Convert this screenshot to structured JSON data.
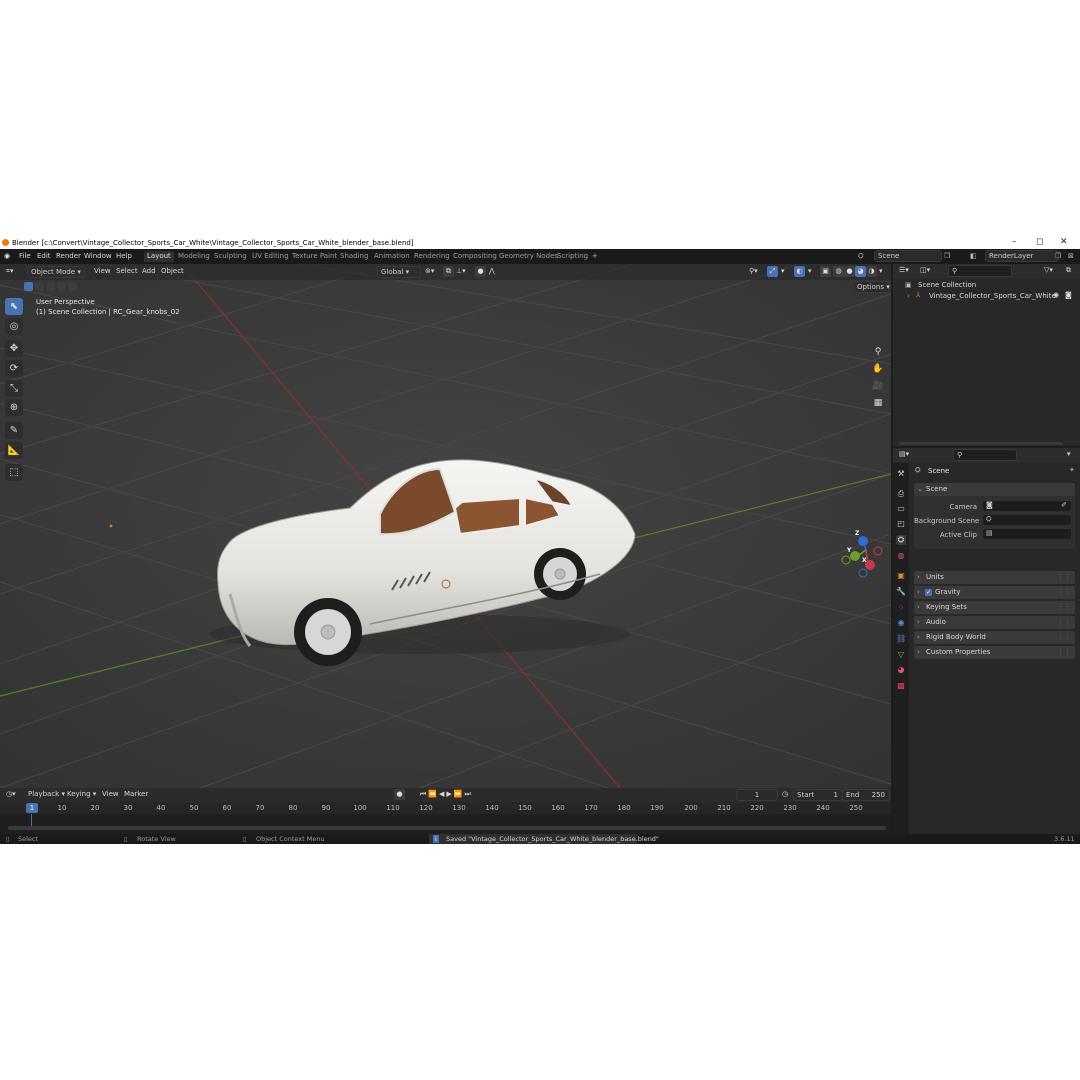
{
  "window": {
    "title": "Blender [c:\\Convert\\Vintage_Collector_Sports_Car_White\\Vintage_Collector_Sports_Car_White_blender_base.blend]",
    "minimize": "–",
    "maximize": "◻",
    "close": "✕"
  },
  "menu": [
    "File",
    "Edit",
    "Render",
    "Window",
    "Help"
  ],
  "workspaces": [
    "Layout",
    "Modeling",
    "Sculpting",
    "UV Editing",
    "Texture Paint",
    "Shading",
    "Animation",
    "Rendering",
    "Compositing",
    "Geometry Nodes",
    "Scripting"
  ],
  "add_workspace": "+",
  "scene_field": "Scene",
  "render_layer_field": "RenderLayer",
  "viewport": {
    "mode": "Object Mode",
    "menus": [
      "View",
      "Select",
      "Add",
      "Object"
    ],
    "transform_orientation": "Global",
    "options": "Options",
    "overlay_title": "User Perspective",
    "overlay_sub": "(1) Scene Collection | RC_Gear_knobs_02",
    "gizmo": {
      "z": "Z",
      "y": "Y",
      "x": "X"
    }
  },
  "timeline": {
    "menus": [
      "Playback",
      "Keying",
      "View",
      "Marker"
    ],
    "current_frame": "1",
    "start_label": "Start",
    "start": "1",
    "end_label": "End",
    "end": "250",
    "ticks": [
      "1",
      "10",
      "20",
      "30",
      "40",
      "50",
      "60",
      "70",
      "80",
      "90",
      "100",
      "110",
      "120",
      "130",
      "140",
      "150",
      "160",
      "170",
      "180",
      "190",
      "200",
      "210",
      "220",
      "230",
      "240",
      "250"
    ]
  },
  "status": {
    "select": "Select",
    "rotate": "Rotate View",
    "context": "Object Context Menu",
    "message": "Saved \"Vintage_Collector_Sports_Car_White_blender_base.blend\"",
    "version": "3.6.11"
  },
  "outliner": {
    "root": "Scene Collection",
    "item": "Vintage_Collector_Sports_Car_White"
  },
  "properties": {
    "header": "Scene",
    "scene_panel": "Scene",
    "camera_label": "Camera",
    "background_label": "Background Scene",
    "clip_label": "Active Clip",
    "panels": [
      "Units",
      "Gravity",
      "Keying Sets",
      "Audio",
      "Rigid Body World",
      "Custom Properties"
    ]
  },
  "colors": {
    "accent": "#4772b3",
    "x_axis": "#c33c45",
    "y_axis": "#6e9e2a",
    "z_axis": "#2f6fd1",
    "viewport_bg": "#3a3a3a"
  }
}
